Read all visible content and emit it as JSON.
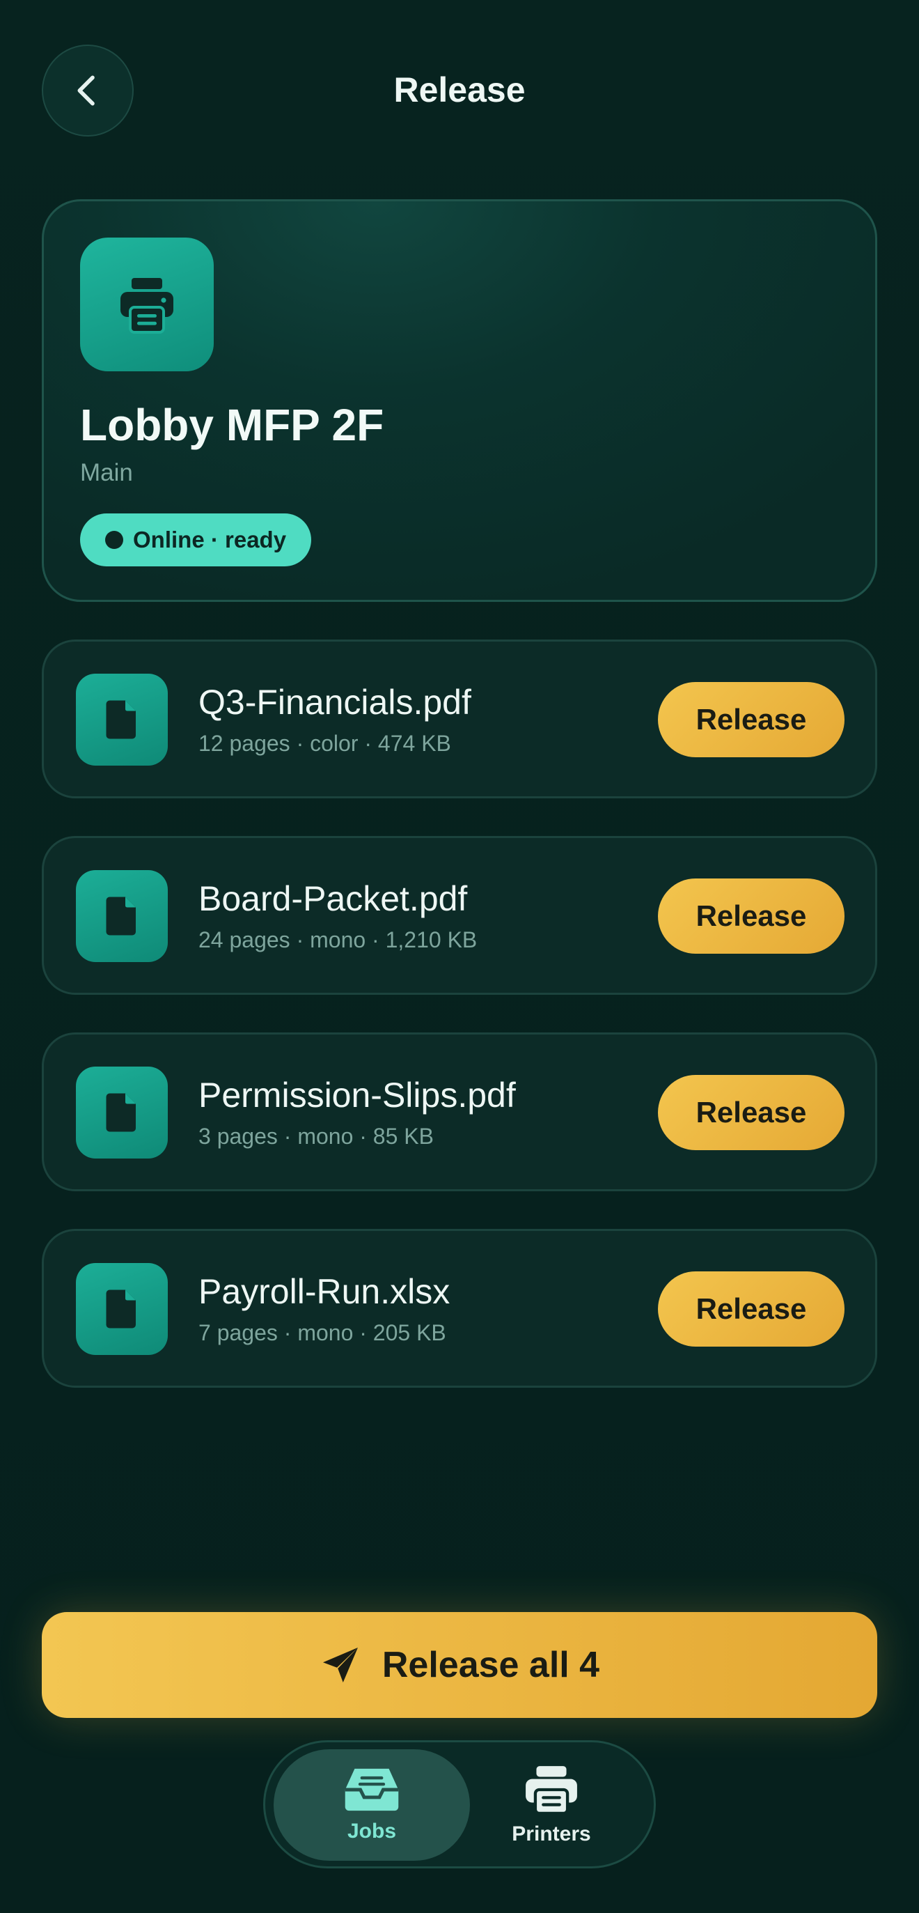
{
  "header": {
    "title": "Release",
    "back_icon": "chevron-left-icon"
  },
  "printer": {
    "name": "Lobby MFP 2F",
    "location": "Main",
    "status": "Online · ready",
    "icon": "printer-icon"
  },
  "jobs": [
    {
      "name": "Q3-Financials.pdf",
      "meta": "12 pages · color · 474 KB",
      "action": "Release"
    },
    {
      "name": "Board-Packet.pdf",
      "meta": "24 pages · mono · 1,210 KB",
      "action": "Release"
    },
    {
      "name": "Permission-Slips.pdf",
      "meta": "3 pages · mono · 85 KB",
      "action": "Release"
    },
    {
      "name": "Payroll-Run.xlsx",
      "meta": "7 pages · mono · 205 KB",
      "action": "Release"
    }
  ],
  "release_all": {
    "label": "Release all 4",
    "icon": "send-icon"
  },
  "nav": {
    "items": [
      {
        "label": "Jobs",
        "icon": "inbox-icon",
        "active": true
      },
      {
        "label": "Printers",
        "icon": "printer-icon",
        "active": false
      }
    ]
  },
  "colors": {
    "background": "#06201d",
    "accent_teal": "#4fdcc2",
    "accent_gold": "#f3c54e"
  }
}
